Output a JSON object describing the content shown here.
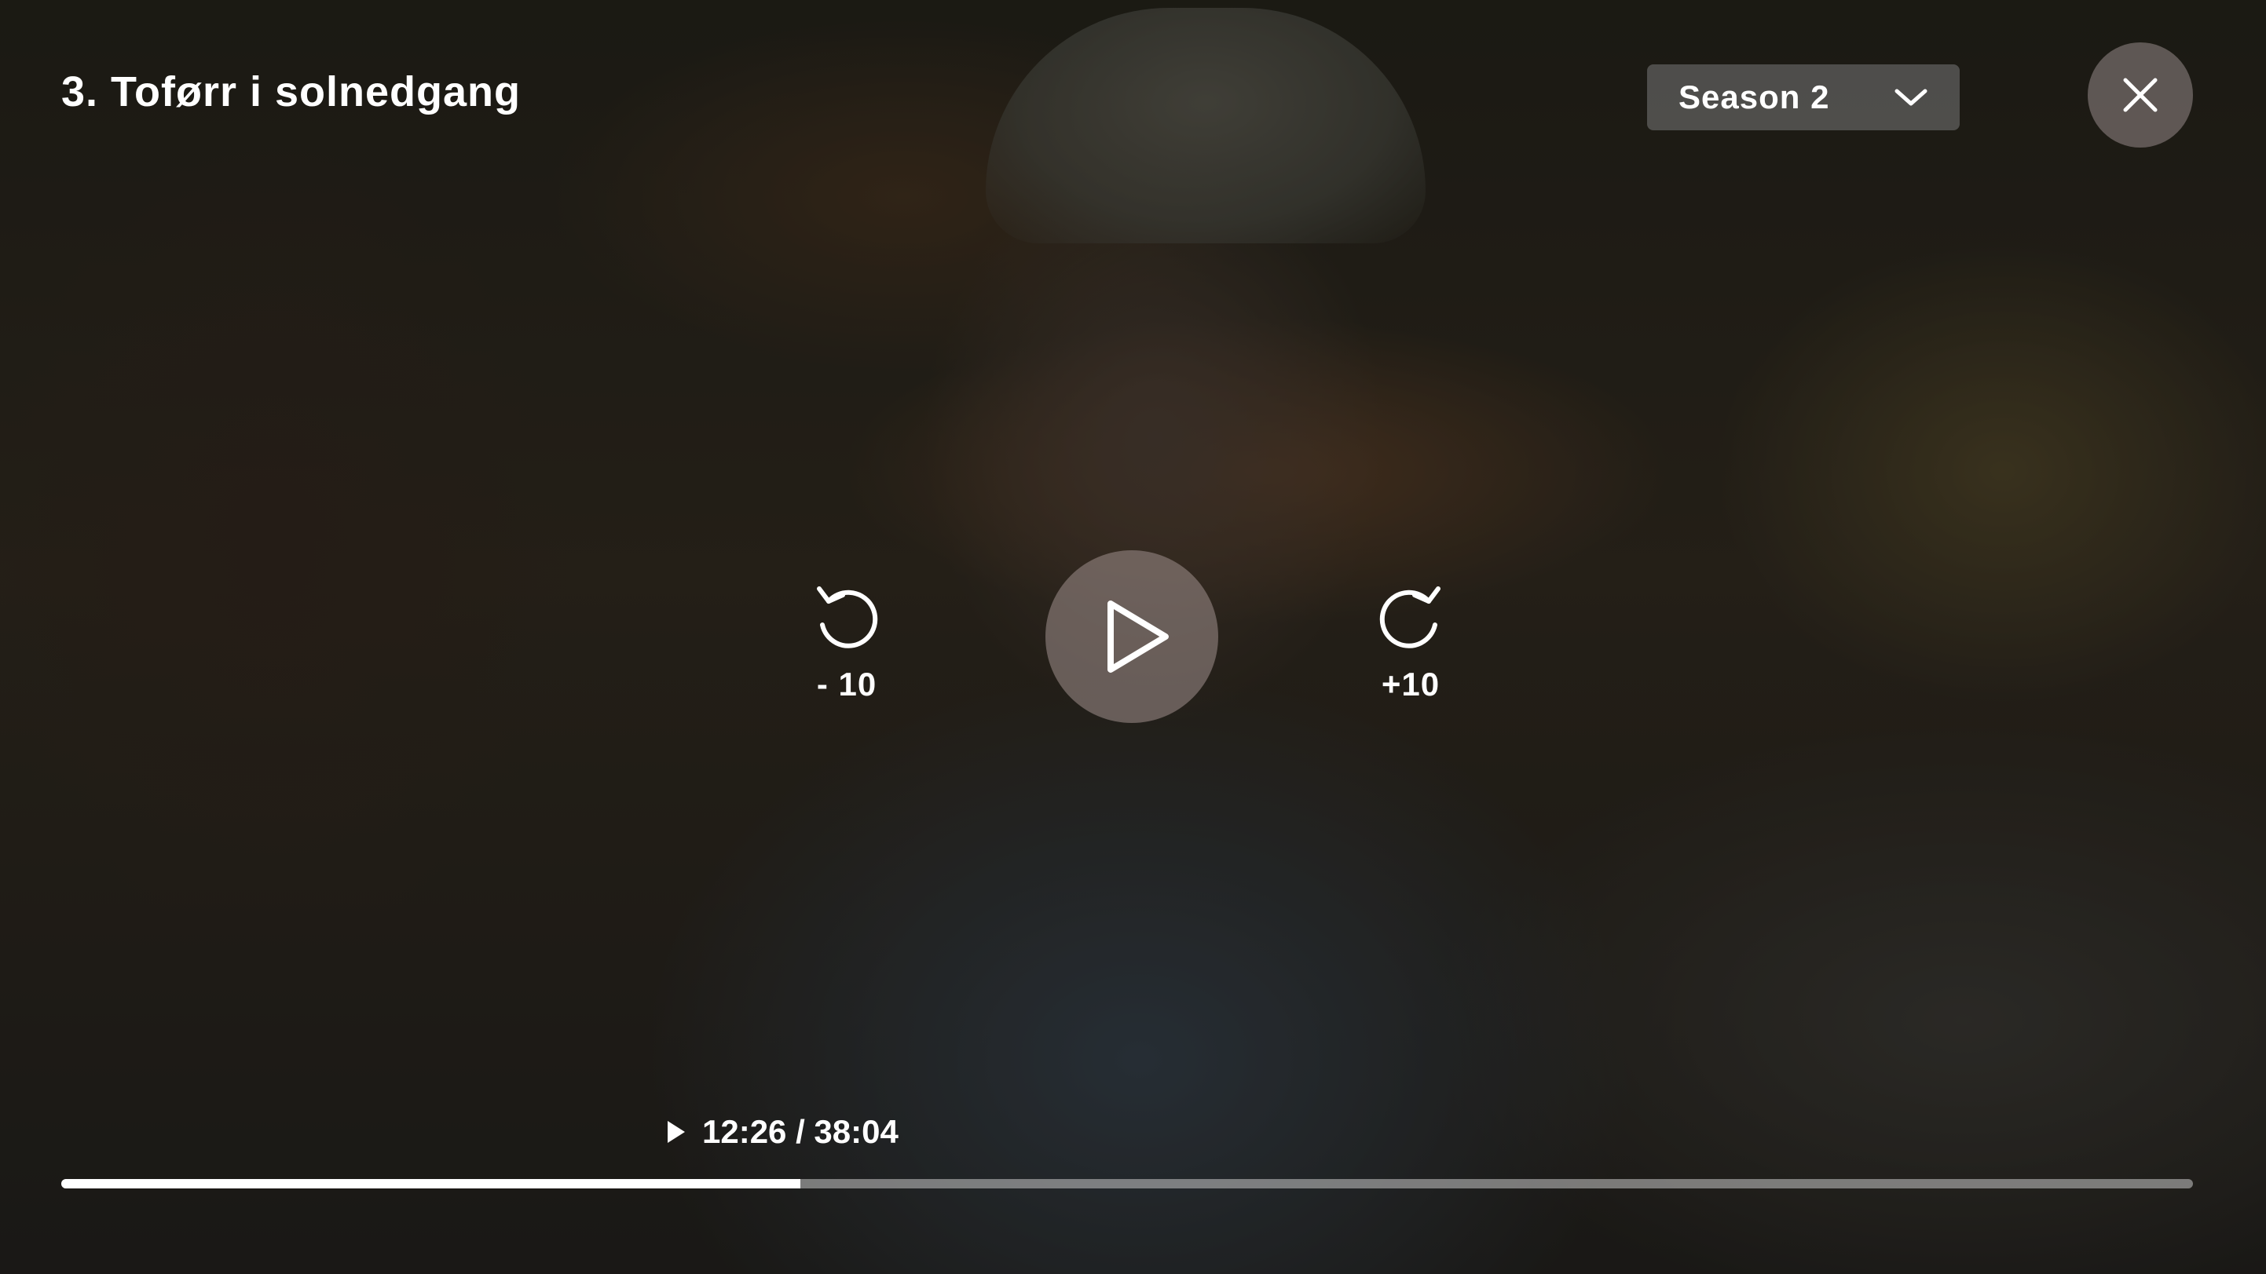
{
  "episode": {
    "title": "3. Toførr i solnedgang"
  },
  "season_select": {
    "selected": "Season 2",
    "icon": "chevron-down-icon"
  },
  "close_button": {
    "icon": "close-icon"
  },
  "controls": {
    "rewind_label": "- 10",
    "rewind_icon": "rewind-icon",
    "play_icon": "play-icon",
    "forward_label": "+10",
    "forward_icon": "forward-icon"
  },
  "playback": {
    "time_text": "12:26 / 38:04",
    "current": "12:26",
    "duration": "38:04",
    "progress_fraction": 0.3467
  },
  "colors": {
    "text": "#ffffff",
    "progress_fill": "#ffffff",
    "progress_track": "#c8c8c8"
  }
}
